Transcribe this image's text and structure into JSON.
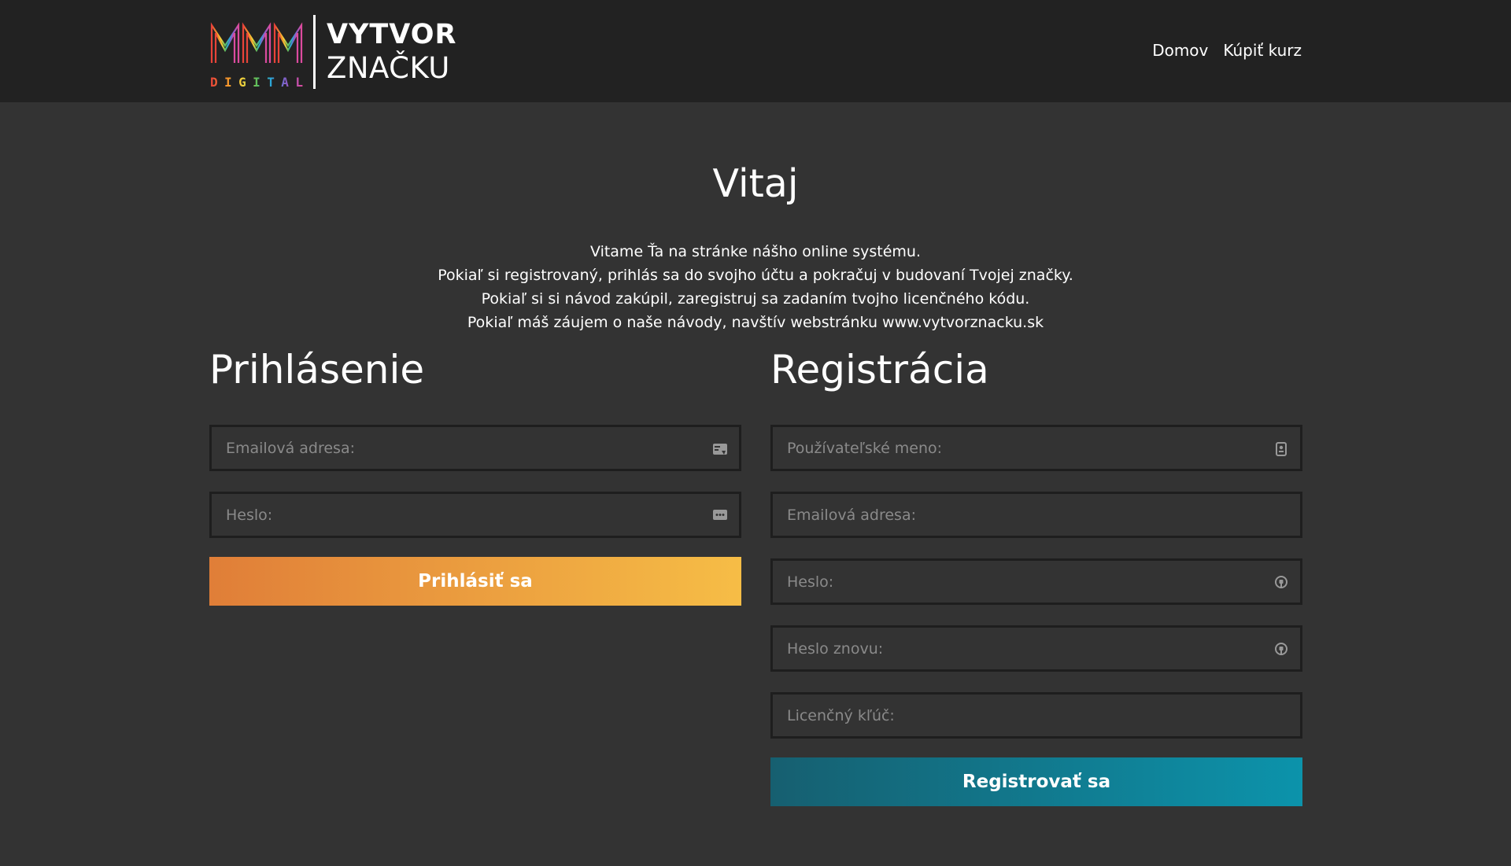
{
  "header": {
    "logo": {
      "mark_text": "MMM",
      "mark_subtext": "DIGITAL",
      "line1": "VYTVOR",
      "line2": "ZNAČKU",
      "mark_colors": [
        "#e8403a",
        "#f59a2b",
        "#f3d33c",
        "#5fbf5a",
        "#2aa8d8",
        "#8a5cc9",
        "#e04a9c"
      ]
    },
    "nav": [
      {
        "label": "Domov"
      },
      {
        "label": "Kúpiť kurz"
      }
    ]
  },
  "welcome": {
    "title": "Vitaj",
    "lines": [
      "Vitame Ťa na stránke nášho online systému.",
      "Pokiaľ si registrovaný, prihlás sa do svojho účtu a pokračuj v budovaní Tvojej značky.",
      "Pokiaľ si si návod zakúpil, zaregistruj sa zadaním tvojho licenčného kódu.",
      "Pokiaľ máš záujem o naše návody, navštív webstránku www.vytvorznacku.sk"
    ]
  },
  "login": {
    "title": "Prihlásenie",
    "email_placeholder": "Emailová adresa:",
    "password_placeholder": "Heslo:",
    "email_icon": "id-card-icon",
    "password_icon": "password-dots-icon",
    "submit_label": "Prihlásiť sa"
  },
  "register": {
    "title": "Registrácia",
    "username_placeholder": "Používateľské meno:",
    "email_placeholder": "Emailová adresa:",
    "password_placeholder": "Heslo:",
    "password_again_placeholder": "Heslo znovu:",
    "license_placeholder": "Licenčný kľúč:",
    "username_icon": "user-badge-icon",
    "password_icon": "lock-icon",
    "submit_label": "Registrovať sa"
  },
  "colors": {
    "header_bg": "#222222",
    "page_bg": "#333333",
    "login_button_from": "#e07e38",
    "login_button_to": "#f6bd46",
    "register_button_from": "#165f70",
    "register_button_to": "#0c93ab"
  }
}
